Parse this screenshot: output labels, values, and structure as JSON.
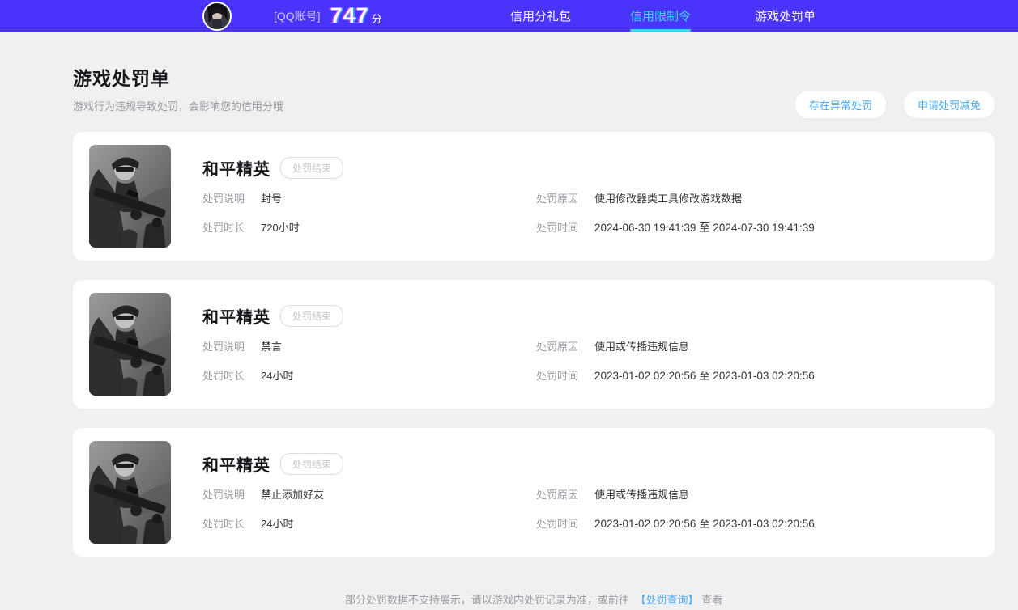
{
  "colors": {
    "navbar_bg": "#4a33fb",
    "active_tab": "#3bd9e6",
    "accent_blue": "#4aabf4",
    "page_bg": "#f0f0f1",
    "card_bg": "#ffffff"
  },
  "nav": {
    "score_prefix": "[QQ账号]",
    "score_value": "747",
    "score_unit": "分",
    "items": [
      {
        "label": "信用分礼包",
        "active": false
      },
      {
        "label": "信用限制令",
        "active": true
      },
      {
        "label": "游戏处罚单",
        "active": false
      }
    ]
  },
  "header": {
    "title": "游戏处罚单",
    "subtitle": "游戏行为违规导致处罚，会影响您的信用分哦",
    "buttons": [
      {
        "label": "存在异常处罚"
      },
      {
        "label": "申请处罚减免"
      }
    ]
  },
  "labels": {
    "desc": "处罚说明",
    "duration": "处罚时长",
    "reason": "处罚原因",
    "time": "处罚时间"
  },
  "cards": [
    {
      "game": "和平精英",
      "status": "处罚结束",
      "desc": "封号",
      "duration": "720小时",
      "reason": "使用修改器类工具修改游戏数据",
      "time": "2024-06-30 19:41:39 至 2024-07-30 19:41:39"
    },
    {
      "game": "和平精英",
      "status": "处罚结束",
      "desc": "禁言",
      "duration": "24小时",
      "reason": "使用或传播违规信息",
      "time": "2023-01-02 02:20:56 至 2023-01-03 02:20:56"
    },
    {
      "game": "和平精英",
      "status": "处罚结束",
      "desc": "禁止添加好友",
      "duration": "24小时",
      "reason": "使用或传播违规信息",
      "time": "2023-01-02 02:20:56 至 2023-01-03 02:20:56"
    }
  ],
  "footer": {
    "text_before": "部分处罚数据不支持展示，请以游戏内处罚记录为准，或前往",
    "link": "【处罚查询】",
    "text_after": "查看"
  }
}
